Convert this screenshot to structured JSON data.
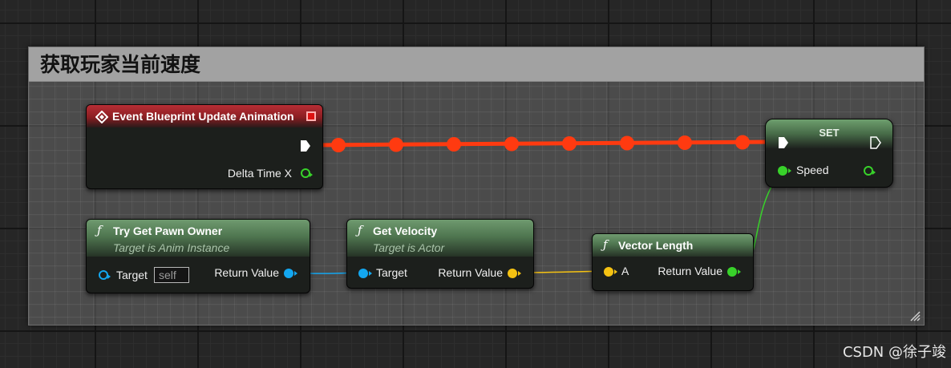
{
  "comment": {
    "title": "获取玩家当前速度"
  },
  "nodes": {
    "event_update": {
      "title": "Event Blueprint Update Animation",
      "output_label": "Delta Time X",
      "header_color": "#b72e35"
    },
    "try_get_pawn_owner": {
      "title": "Try Get Pawn Owner",
      "subtitle": "Target is Anim Instance",
      "target_label": "Target",
      "target_value": "self",
      "return_label": "Return Value"
    },
    "get_velocity": {
      "title": "Get Velocity",
      "subtitle": "Target is Actor",
      "target_label": "Target",
      "return_label": "Return Value"
    },
    "vector_length": {
      "title": "Vector Length",
      "input_label": "A",
      "return_label": "Return Value"
    },
    "set_speed": {
      "title": "SET",
      "variable_label": "Speed"
    }
  },
  "pin_colors": {
    "object": "#13a7f0",
    "vector": "#f5c212",
    "float": "#38d22a",
    "exec": "#ffffff",
    "exec_wire": "#ff3a10"
  },
  "icons": {
    "function": "function-icon",
    "event": "event-diamond-icon"
  },
  "watermark": "CSDN @徐子竣"
}
